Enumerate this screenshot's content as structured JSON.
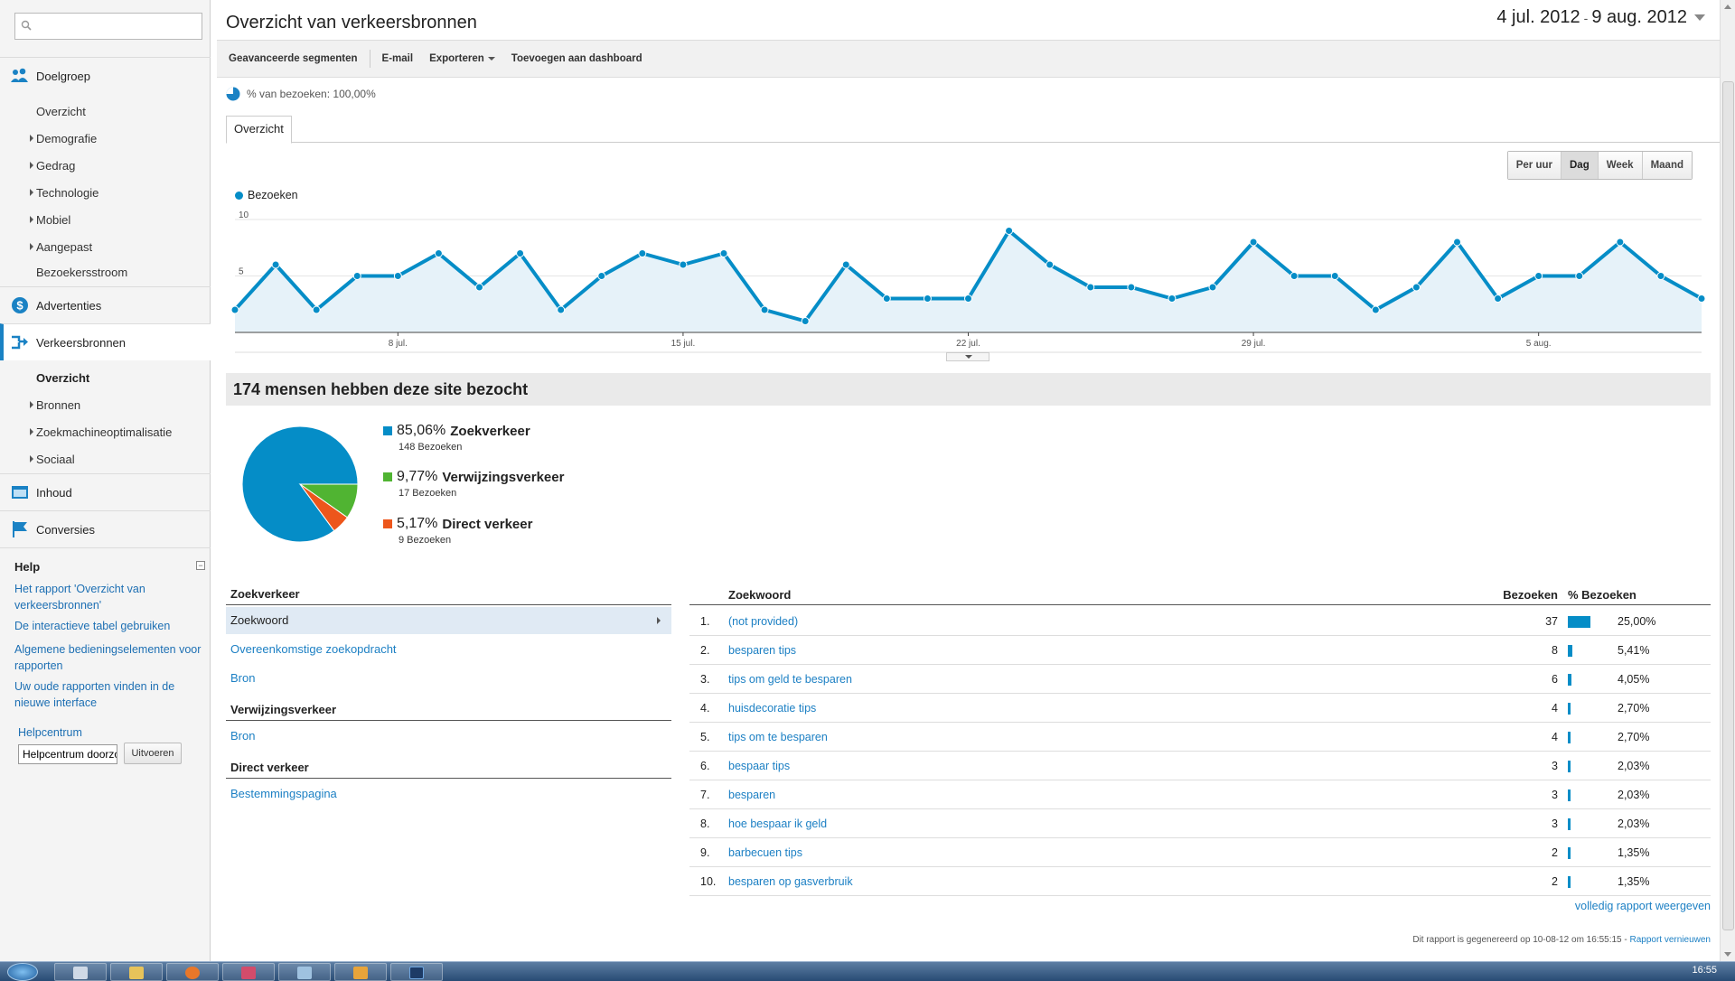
{
  "sidebar": {
    "search_placeholder": "",
    "sections": {
      "audience": "Doelgroep",
      "ads": "Advertenties",
      "traffic": "Verkeersbronnen",
      "content": "Inhoud",
      "conversions": "Conversies"
    },
    "audience_items": [
      "Overzicht",
      "Demografie",
      "Gedrag",
      "Technologie",
      "Mobiel",
      "Aangepast",
      "Bezoekersstroom"
    ],
    "traffic_items": [
      "Overzicht",
      "Bronnen",
      "Zoekmachineoptimalisatie",
      "Sociaal"
    ],
    "help": {
      "title": "Help",
      "links": [
        "Het rapport 'Overzicht van verkeersbronnen'",
        "De interactieve tabel gebruiken",
        "Algemene bedieningselementen voor rapporten",
        "Uw oude rapporten vinden in de nieuwe interface"
      ],
      "helpcenter_label": "Helpcentrum",
      "helpcenter_input": "Helpcentrum doorzoeken",
      "run_button": "Uitvoeren"
    }
  },
  "header": {
    "title": "Overzicht van verkeersbronnen",
    "date_start": "4 jul. 2012",
    "date_sep": "-",
    "date_end": "9 aug. 2012"
  },
  "toolbar": {
    "advanced_segments": "Geavanceerde segmenten",
    "email": "E-mail",
    "export": "Exporteren",
    "add_to_dashboard": "Toevoegen aan dashboard"
  },
  "segment": {
    "label": "% van bezoeken: 100,00%"
  },
  "tabs": [
    "Overzicht"
  ],
  "granularity": {
    "options": [
      "Per uur",
      "Dag",
      "Week",
      "Maand"
    ],
    "selected": "Dag"
  },
  "chart_data": [
    {
      "type": "area",
      "legend": "Bezoeken",
      "ylim": [
        0,
        10
      ],
      "yticks": [
        "10",
        "5"
      ],
      "xtick_labels": [
        "8 jul.",
        "15 jul.",
        "22 jul.",
        "29 jul.",
        "5 aug."
      ],
      "series": [
        {
          "name": "Bezoeken",
          "color": "#058dc7",
          "values": [
            2,
            6,
            2,
            5,
            5,
            7,
            4,
            7,
            2,
            5,
            7,
            6,
            7,
            2,
            1,
            6,
            3,
            3,
            3,
            9,
            6,
            4,
            4,
            3,
            4,
            8,
            5,
            5,
            2,
            4,
            8,
            3,
            5,
            5,
            8,
            5,
            3
          ]
        }
      ]
    },
    {
      "type": "pie",
      "slices": [
        {
          "label": "Zoekverkeer",
          "percent": 85.06,
          "pct_text": "85,06%",
          "visits_text": "148 Bezoeken",
          "color": "#058dc7"
        },
        {
          "label": "Verwijzingsverkeer",
          "percent": 9.77,
          "pct_text": "9,77%",
          "visits_text": "17 Bezoeken",
          "color": "#50b432"
        },
        {
          "label": "Direct verkeer",
          "percent": 5.17,
          "pct_text": "5,17%",
          "visits_text": "9 Bezoeken",
          "color": "#ed561b"
        }
      ]
    }
  ],
  "summary": {
    "title": "174 mensen hebben deze site bezocht"
  },
  "dimensions": {
    "search_header": "Zoekverkeer",
    "search_items": [
      "Zoekwoord",
      "Overeenkomstige zoekopdracht",
      "Bron"
    ],
    "referral_header": "Verwijzingsverkeer",
    "referral_items": [
      "Bron"
    ],
    "direct_header": "Direct verkeer",
    "direct_items": [
      "Bestemmingspagina"
    ]
  },
  "keyword_table": {
    "headers": {
      "keyword": "Zoekwoord",
      "visits": "Bezoeken",
      "pct": "% Bezoeken"
    },
    "rows": [
      {
        "idx": "1.",
        "keyword": "(not provided)",
        "visits": "37",
        "pct": "25,00%",
        "share": 25.0
      },
      {
        "idx": "2.",
        "keyword": "besparen tips",
        "visits": "8",
        "pct": "5,41%",
        "share": 5.41
      },
      {
        "idx": "3.",
        "keyword": "tips om geld te besparen",
        "visits": "6",
        "pct": "4,05%",
        "share": 4.05
      },
      {
        "idx": "4.",
        "keyword": "huisdecoratie tips",
        "visits": "4",
        "pct": "2,70%",
        "share": 2.7
      },
      {
        "idx": "5.",
        "keyword": "tips om te besparen",
        "visits": "4",
        "pct": "2,70%",
        "share": 2.7
      },
      {
        "idx": "6.",
        "keyword": "bespaar tips",
        "visits": "3",
        "pct": "2,03%",
        "share": 2.03
      },
      {
        "idx": "7.",
        "keyword": "besparen",
        "visits": "3",
        "pct": "2,03%",
        "share": 2.03
      },
      {
        "idx": "8.",
        "keyword": "hoe bespaar ik geld",
        "visits": "3",
        "pct": "2,03%",
        "share": 2.03
      },
      {
        "idx": "9.",
        "keyword": "barbecuen tips",
        "visits": "2",
        "pct": "1,35%",
        "share": 1.35
      },
      {
        "idx": "10.",
        "keyword": "besparen op gasverbruik",
        "visits": "2",
        "pct": "1,35%",
        "share": 1.35
      }
    ],
    "full_report": "volledig rapport weergeven"
  },
  "footer": {
    "generated": "Dit rapport is gegenereerd op 10-08-12 om 16:55:15 - ",
    "refresh": "Rapport vernieuwen"
  },
  "taskbar": {
    "clock": "16:55"
  }
}
